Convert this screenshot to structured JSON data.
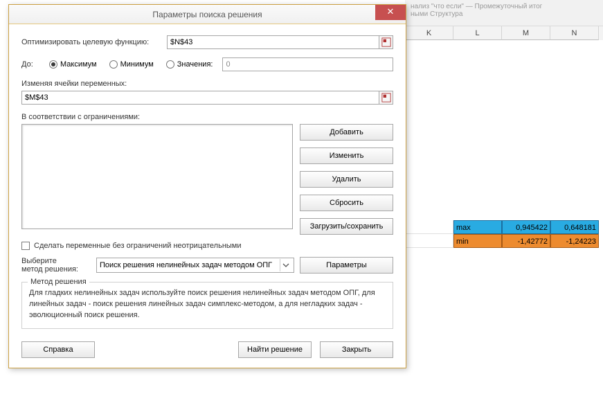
{
  "ribbon": {
    "line1": "нализ \"что если\"  —  Промежуточный итог",
    "line2": "ными                  Структура"
  },
  "columns": [
    "K",
    "L",
    "M",
    "N"
  ],
  "cells": {
    "max_label": "max",
    "max_m": "0,945422",
    "max_n": "0,648181",
    "min_label": "min",
    "min_m": "-1,42772",
    "min_n": "-1,24223"
  },
  "dialog": {
    "title": "Параметры поиска решения",
    "close": "✕",
    "optimize_label": "Оптимизировать целевую функцию:",
    "objective": "$N$43",
    "to_label": "До:",
    "radio_max": "Максимум",
    "radio_min": "Минимум",
    "radio_val": "Значения:",
    "value_field": "0",
    "changing_label": "Изменяя ячейки переменных:",
    "changing_value": "$M$43",
    "constraints_label": "В соответствии с ограничениями:",
    "btn_add": "Добавить",
    "btn_change": "Изменить",
    "btn_delete": "Удалить",
    "btn_reset": "Сбросить",
    "btn_loadsave": "Загрузить/сохранить",
    "chk_nonneg": "Сделать переменные без ограничений неотрицательными",
    "method_label1": "Выберите",
    "method_label2": "метод решения:",
    "method_value": "Поиск решения нелинейных задач методом ОПГ",
    "btn_params": "Параметры",
    "group_title": "Метод решения",
    "desc": "Для гладких нелинейных задач используйте поиск решения нелинейных задач методом ОПГ, для линейных задач - поиск решения линейных задач симплекс-методом, а для негладких задач - эволюционный поиск решения.",
    "btn_help": "Справка",
    "btn_solve": "Найти решение",
    "btn_close": "Закрыть"
  }
}
